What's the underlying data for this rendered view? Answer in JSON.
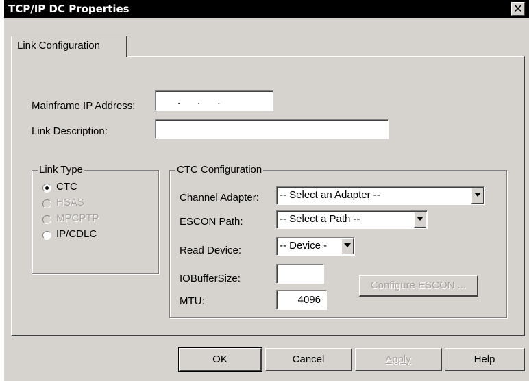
{
  "window": {
    "title": "TCP/IP DC Properties",
    "close_glyph": "✕"
  },
  "tabs": [
    {
      "label": "Link Configuration"
    }
  ],
  "form": {
    "mainframe_ip_label": "Mainframe IP Address:",
    "mainframe_ip_value": ".      .      .",
    "link_description_label": "Link Description:",
    "link_description_value": ""
  },
  "link_type": {
    "legend": "Link Type",
    "options": [
      {
        "label": "CTC",
        "selected": true,
        "enabled": true
      },
      {
        "label": "HSAS",
        "selected": false,
        "enabled": false
      },
      {
        "label": "MPCPTP",
        "selected": false,
        "enabled": false
      },
      {
        "label": "IP/CDLC",
        "selected": false,
        "enabled": true
      }
    ]
  },
  "ctc": {
    "legend": "CTC Configuration",
    "channel_adapter_label": "Channel Adapter:",
    "channel_adapter_value": "-- Select an Adapter --",
    "escon_path_label": "ESCON Path:",
    "escon_path_value": "-- Select a Path --",
    "read_device_label": "Read Device:",
    "read_device_value": "-- Device -",
    "iobuffer_label": "IOBufferSize:",
    "iobuffer_value": "",
    "mtu_label": "MTU:",
    "mtu_value": "4096",
    "configure_escon_label": "Configure ESCON ..."
  },
  "buttons": {
    "ok": "OK",
    "cancel": "Cancel",
    "apply": "Apply",
    "help": "Help"
  }
}
